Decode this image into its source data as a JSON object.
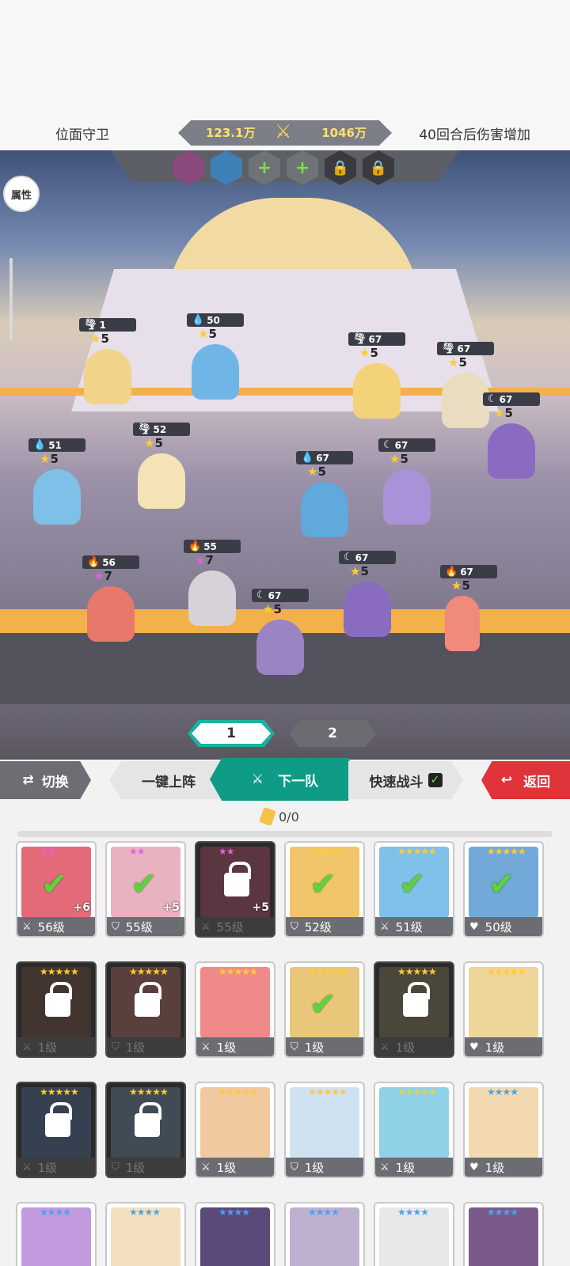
{
  "header": {
    "left_label": "位面守卫",
    "right_label": "40回合后伤害增加",
    "power_left": "123.1万",
    "power_right": "1046万"
  },
  "attribute_button": "属性",
  "slots": [
    "hero",
    "hero",
    "+",
    "+",
    "🔒",
    "🔒"
  ],
  "units": [
    {
      "level": "1",
      "stars": "5",
      "element": "wind"
    },
    {
      "level": "50",
      "stars": "5",
      "element": "water"
    },
    {
      "level": "67",
      "stars": "5",
      "element": "wind"
    },
    {
      "level": "67",
      "stars": "5",
      "element": "wind"
    },
    {
      "level": "67",
      "stars": "5",
      "element": "dark"
    },
    {
      "level": "51",
      "stars": "5",
      "element": "water"
    },
    {
      "level": "52",
      "stars": "5",
      "element": "wind"
    },
    {
      "level": "67",
      "stars": "5",
      "element": "water"
    },
    {
      "level": "67",
      "stars": "5",
      "element": "dark"
    },
    {
      "level": "56",
      "stars": "7",
      "element": "fire"
    },
    {
      "level": "55",
      "stars": "7",
      "element": "fire"
    },
    {
      "level": "67",
      "stars": "5",
      "element": "dark"
    },
    {
      "level": "67",
      "stars": "5",
      "element": "dark"
    },
    {
      "level": "67",
      "stars": "5",
      "element": "fire"
    }
  ],
  "team_tabs": [
    "1",
    "2"
  ],
  "actions": {
    "switch": "切换",
    "auto_deploy": "一键上阵",
    "next_team": "下一队",
    "fast_battle": "快速战斗",
    "back": "返回"
  },
  "ticket_count": "0/0",
  "cards": [
    {
      "level": "56级",
      "stars": "★★",
      "star_color": "p",
      "state": "selected",
      "plus": "+6"
    },
    {
      "level": "55级",
      "stars": "★★",
      "star_color": "p",
      "state": "selected",
      "plus": "+5"
    },
    {
      "level": "55级",
      "stars": "★★",
      "star_color": "p",
      "state": "locked",
      "plus": "+5"
    },
    {
      "level": "52级",
      "stars": "★★★★★",
      "star_color": "y",
      "state": "selected",
      "plus": ""
    },
    {
      "level": "51级",
      "stars": "★★★★★",
      "star_color": "y",
      "state": "selected",
      "plus": ""
    },
    {
      "level": "50级",
      "stars": "★★★★★",
      "star_color": "y",
      "state": "selected",
      "plus": ""
    },
    {
      "level": "1级",
      "stars": "★★★★★",
      "star_color": "y",
      "state": "locked",
      "plus": ""
    },
    {
      "level": "1级",
      "stars": "★★★★★",
      "star_color": "y",
      "state": "locked",
      "plus": ""
    },
    {
      "level": "1级",
      "stars": "★★★★★",
      "star_color": "y",
      "state": "normal",
      "plus": ""
    },
    {
      "level": "1级",
      "stars": "★★★★★",
      "star_color": "y",
      "state": "selected",
      "plus": ""
    },
    {
      "level": "1级",
      "stars": "★★★★★",
      "star_color": "y",
      "state": "locked",
      "plus": ""
    },
    {
      "level": "1级",
      "stars": "★★★★★",
      "star_color": "y",
      "state": "normal",
      "plus": ""
    },
    {
      "level": "1级",
      "stars": "★★★★★",
      "star_color": "y",
      "state": "locked",
      "plus": ""
    },
    {
      "level": "1级",
      "stars": "★★★★★",
      "star_color": "y",
      "state": "locked",
      "plus": ""
    },
    {
      "level": "1级",
      "stars": "★★★★★",
      "star_color": "y",
      "state": "normal",
      "plus": ""
    },
    {
      "level": "1级",
      "stars": "★★★★★",
      "star_color": "y",
      "state": "normal",
      "plus": ""
    },
    {
      "level": "1级",
      "stars": "★★★★★",
      "star_color": "y",
      "state": "normal",
      "plus": ""
    },
    {
      "level": "1级",
      "stars": "★★★★",
      "star_color": "b",
      "state": "normal",
      "plus": ""
    },
    {
      "level": "",
      "stars": "★★★★",
      "star_color": "b",
      "state": "normal",
      "plus": ""
    },
    {
      "level": "",
      "stars": "★★★★",
      "star_color": "b",
      "state": "normal",
      "plus": ""
    },
    {
      "level": "",
      "stars": "★★★★",
      "star_color": "b",
      "state": "normal",
      "plus": ""
    },
    {
      "level": "",
      "stars": "★★★★",
      "star_color": "b",
      "state": "normal",
      "plus": ""
    },
    {
      "level": "",
      "stars": "★★★★",
      "star_color": "b",
      "state": "normal",
      "plus": ""
    },
    {
      "level": "",
      "stars": "★★★★",
      "star_color": "b",
      "state": "normal",
      "plus": ""
    }
  ],
  "colors": {
    "accent_teal": "#0f9c87",
    "back_red": "#e0333a",
    "star_gold": "#ffcc2e",
    "check_green": "#5fd23d"
  }
}
